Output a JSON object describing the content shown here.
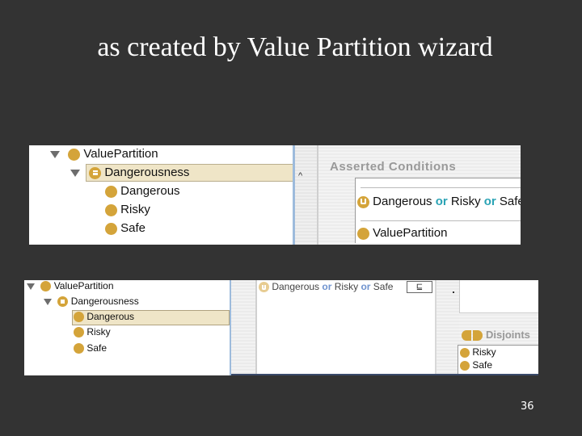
{
  "slide": {
    "title": "as created by Value Partition wizard",
    "page_number": "36"
  },
  "screenshot_1": {
    "tree": [
      {
        "label": "ValuePartition",
        "icon": "class-circle-icon",
        "expanded": true
      },
      {
        "label": "Dangerousness",
        "icon": "equivalent-class-icon",
        "expanded": true,
        "selected": true
      },
      {
        "label": "Dangerous",
        "icon": "class-circle-icon"
      },
      {
        "label": "Risky",
        "icon": "class-circle-icon"
      },
      {
        "label": "Safe",
        "icon": "class-circle-icon"
      }
    ],
    "asserted_conditions": {
      "title": "Asserted Conditions",
      "union": {
        "a": "Dangerous",
        "or1": "or",
        "b": "Risky",
        "or2": "or",
        "c": "Safe"
      },
      "superclass": "ValuePartition"
    },
    "collapse_glyph": "^"
  },
  "screenshot_2": {
    "tree": [
      {
        "label": "ValuePartition",
        "icon": "class-circle-icon",
        "expanded": true
      },
      {
        "label": "Dangerousness",
        "icon": "equivalent-class-icon",
        "expanded": true
      },
      {
        "label": "Dangerous",
        "icon": "class-circle-icon",
        "selected": true
      },
      {
        "label": "Risky",
        "icon": "class-circle-icon"
      },
      {
        "label": "Safe",
        "icon": "class-circle-icon"
      }
    ],
    "condition": {
      "a": "Dangerous",
      "or1": "or",
      "b": "Risky",
      "or2": "or",
      "c": "Safe",
      "subclass_symbol": "⊑"
    },
    "disjoints": {
      "title": "Disjoints",
      "items": [
        "Risky",
        "Safe"
      ]
    }
  }
}
